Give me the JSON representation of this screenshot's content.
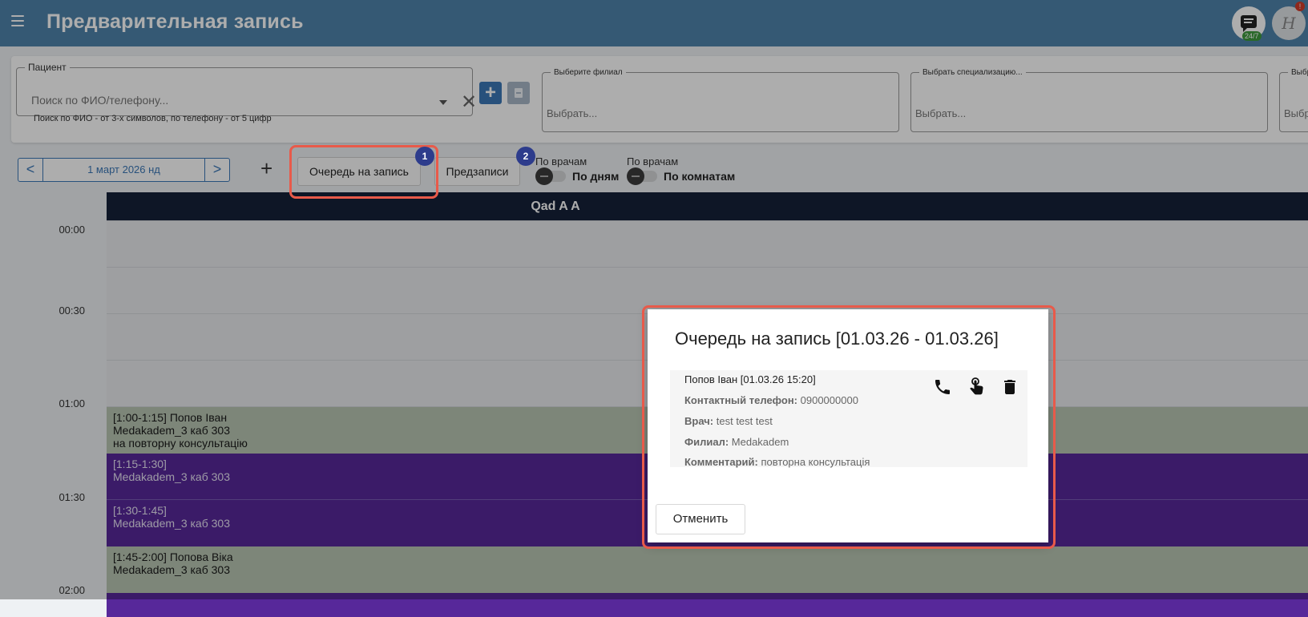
{
  "header": {
    "title": "Предварительная запись",
    "chat_badge": "24/7",
    "user_initials": "Н",
    "user_badge": "!"
  },
  "patient": {
    "legend": "Пациент",
    "placeholder": "Поиск по ФИО/телефону...",
    "hint": "Поиск по ФИО - от 3-х символов, по телефону - от 5 цифр"
  },
  "filters": [
    {
      "legend": "Выберите филиал",
      "value": "Выбрать..."
    },
    {
      "legend": "Выбрать специализацию...",
      "value": "Выбрать..."
    },
    {
      "legend": "Выбр",
      "value": "Выбр"
    }
  ],
  "toolbar": {
    "prev": "<",
    "next": ">",
    "date": "1 март 2026 нд",
    "add": "+",
    "queue_label": "Очередь на запись",
    "prereg_label": "Предзаписи",
    "badge1": "1",
    "badge2": "2",
    "toggle1_small": "По врачам",
    "toggle1_label": "По дням",
    "toggle2_small": "По врачам",
    "toggle2_label": "По комнатам"
  },
  "calendar": {
    "doctor": "Qad A A",
    "times": [
      "00:00",
      "00:30",
      "01:00",
      "01:30",
      "02:00"
    ],
    "events": [
      {
        "lines": [
          "[1:00-1:15] Попов Іван",
          "Medakadem_3  каб 303",
          "на повторну консультацію"
        ]
      },
      {
        "lines": [
          "[1:15-1:30]",
          "Medakadem_3  каб 303"
        ]
      },
      {
        "lines": [
          "[1:30-1:45]",
          "Medakadem_3  каб 303"
        ]
      },
      {
        "lines": [
          "[1:45-2:00] Попова Віка",
          "Medakadem_3  каб 303"
        ]
      }
    ]
  },
  "modal": {
    "title": "Очередь на запись [01.03.26 - 01.03.26]",
    "item": {
      "header": "Попов Іван [01.03.26 15:20]",
      "phone_label": "Контактный телефон:",
      "phone": "0900000000",
      "doctor_label": "Врач:",
      "doctor": "test test test",
      "branch_label": "Филиал:",
      "branch": "Medakadem",
      "comment_label": "Комментарий:",
      "comment": "повторна консультація"
    },
    "cancel": "Отменить"
  }
}
